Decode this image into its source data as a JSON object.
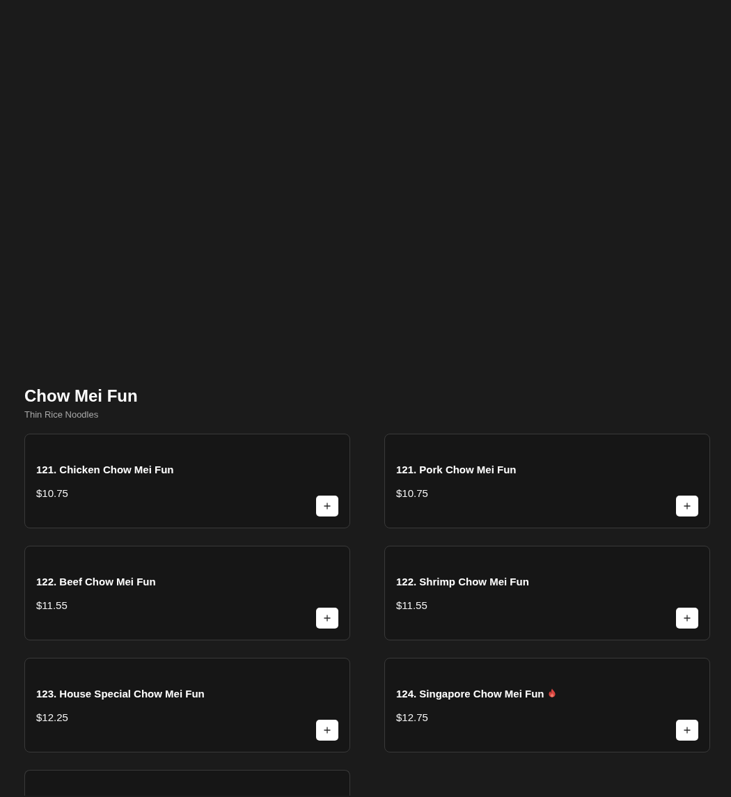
{
  "section": {
    "title": "Chow Mei Fun",
    "subtitle": "Thin Rice Noodles"
  },
  "items": [
    {
      "kind": "dish",
      "name": "121. Chicken Chow Mei Fun",
      "price": "$10.75",
      "spicy": false
    },
    {
      "kind": "dish",
      "name": "121. Pork Chow Mei Fun",
      "price": "$10.75",
      "spicy": false
    },
    {
      "kind": "dish",
      "name": "122. Beef Chow Mei Fun",
      "price": "$11.55",
      "spicy": false
    },
    {
      "kind": "dish",
      "name": "122. Shrimp Chow Mei Fun",
      "price": "$11.55",
      "spicy": false
    },
    {
      "kind": "dish",
      "name": "123. House Special Chow Mei Fun",
      "price": "$12.25",
      "spicy": false
    },
    {
      "kind": "dish",
      "name": "124. Singapore Chow Mei Fun",
      "price": "$12.75",
      "spicy": true
    },
    {
      "kind": "cut-off"
    }
  ]
}
